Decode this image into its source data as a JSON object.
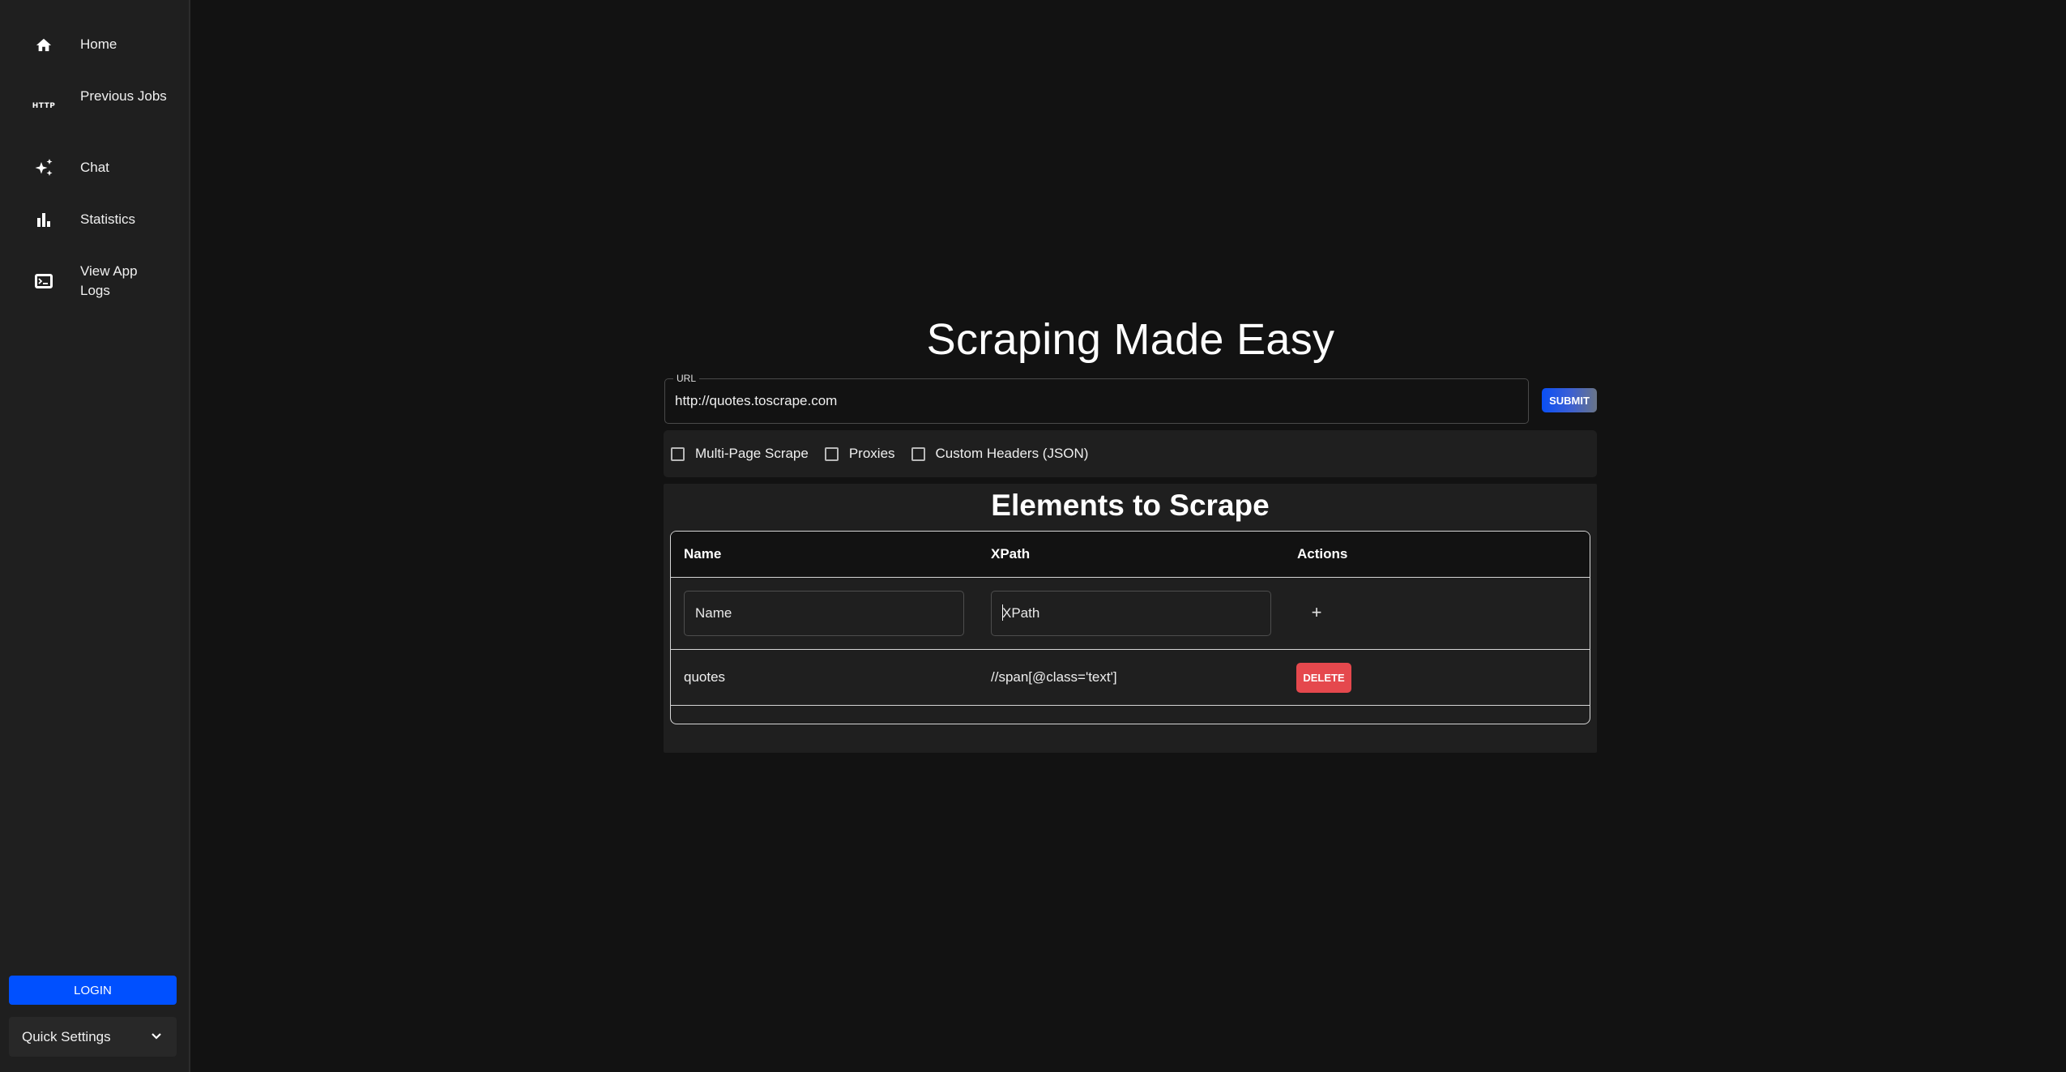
{
  "sidebar": {
    "items": [
      {
        "label": "Home",
        "icon": "home-icon"
      },
      {
        "label": "Previous Jobs",
        "icon": "http-icon"
      },
      {
        "label": "Chat",
        "icon": "sparkles-icon"
      },
      {
        "label": "Statistics",
        "icon": "bar-chart-icon"
      },
      {
        "label": "View App Logs",
        "icon": "terminal-icon"
      }
    ],
    "http_icon_text": "HTTP",
    "login_label": "LOGIN",
    "quick_settings_label": "Quick Settings"
  },
  "main": {
    "title": "Scraping Made Easy",
    "url": {
      "label": "URL",
      "value": "http://quotes.toscrape.com"
    },
    "submit_label": "SUBMIT",
    "options": [
      {
        "label": "Multi-Page Scrape",
        "checked": false
      },
      {
        "label": "Proxies",
        "checked": false
      },
      {
        "label": "Custom Headers (JSON)",
        "checked": false
      }
    ],
    "elements": {
      "title": "Elements to Scrape",
      "columns": [
        "Name",
        "XPath",
        "Actions"
      ],
      "new_row": {
        "name_placeholder": "Name",
        "xpath_placeholder": "XPath",
        "add_label": "+"
      },
      "rows": [
        {
          "name": "quotes",
          "xpath": "//span[@class='text']",
          "action_label": "DELETE"
        }
      ]
    }
  },
  "colors": {
    "primary": "#0050ff",
    "danger": "#e5484d",
    "background": "#121212",
    "surface": "#1f1f1f"
  }
}
